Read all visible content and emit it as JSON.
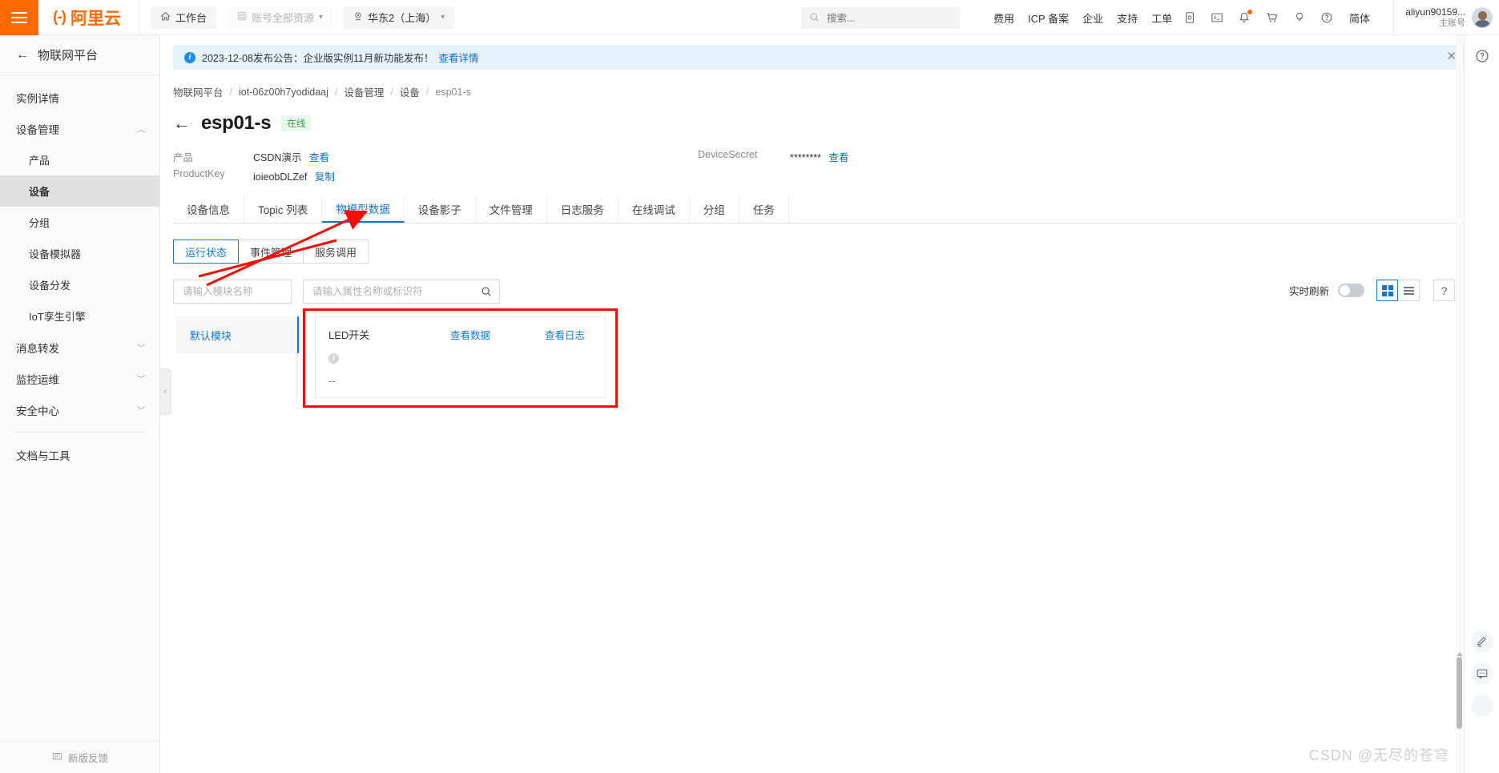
{
  "topbar": {
    "brand": "阿里云",
    "brand_mark": "(-)",
    "workbench": "工作台",
    "resources": "账号全部资源",
    "region": "华东2（上海）",
    "search_placeholder": "搜索...",
    "links": [
      "费用",
      "ICP 备案",
      "企业",
      "支持",
      "工单"
    ],
    "lang": "简体",
    "user_name": "aliyun90159...",
    "user_role": "主账号"
  },
  "sidebar": {
    "title": "物联网平台",
    "items": [
      {
        "label": "实例详情",
        "type": "item"
      },
      {
        "label": "设备管理",
        "type": "group",
        "expanded": true
      },
      {
        "label": "产品",
        "type": "sub"
      },
      {
        "label": "设备",
        "type": "sub",
        "active": true
      },
      {
        "label": "分组",
        "type": "sub"
      },
      {
        "label": "设备模拟器",
        "type": "sub"
      },
      {
        "label": "设备分发",
        "type": "sub"
      },
      {
        "label": "IoT孪生引擎",
        "type": "sub"
      },
      {
        "label": "消息转发",
        "type": "group",
        "expanded": false
      },
      {
        "label": "监控运维",
        "type": "group",
        "expanded": false
      },
      {
        "label": "安全中心",
        "type": "group",
        "expanded": false
      },
      {
        "label": "文档与工具",
        "type": "item"
      }
    ],
    "footer": "新版反馈"
  },
  "banner": {
    "text": "2023-12-08发布公告：企业版实例11月新功能发布！",
    "link": "查看详情"
  },
  "breadcrumb": [
    "物联网平台",
    "iot-06z00h7yodidaaj",
    "设备管理",
    "设备",
    "esp01-s"
  ],
  "page": {
    "title": "esp01-s",
    "status": "在线",
    "meta": {
      "product_label": "产品",
      "product_value": "CSDN演示",
      "product_link": "查看",
      "productkey_label": "ProductKey",
      "productkey_value": "ioieobDLZef",
      "productkey_link": "复制",
      "secret_label": "DeviceSecret",
      "secret_value": "********",
      "secret_link": "查看"
    }
  },
  "tabs": [
    {
      "label": "设备信息"
    },
    {
      "label": "Topic 列表"
    },
    {
      "label": "物模型数据",
      "active": true
    },
    {
      "label": "设备影子"
    },
    {
      "label": "文件管理"
    },
    {
      "label": "日志服务"
    },
    {
      "label": "在线调试"
    },
    {
      "label": "分组"
    },
    {
      "label": "任务"
    }
  ],
  "subtabs": [
    {
      "label": "运行状态",
      "active": true
    },
    {
      "label": "事件管理"
    },
    {
      "label": "服务调用"
    }
  ],
  "filters": {
    "module_placeholder": "请输入模块名称",
    "module_value": "",
    "property_placeholder": "请输入属性名称或标识符",
    "property_value": "",
    "realtime_label": "实时刷新",
    "realtime_on": false,
    "help_label": "?"
  },
  "modules": [
    {
      "label": "默认模块",
      "active": true
    }
  ],
  "properties": [
    {
      "name": "LED开关",
      "view_data": "查看数据",
      "view_log": "查看日志",
      "value": "--"
    }
  ],
  "watermark": "CSDN @无尽的苍穹"
}
